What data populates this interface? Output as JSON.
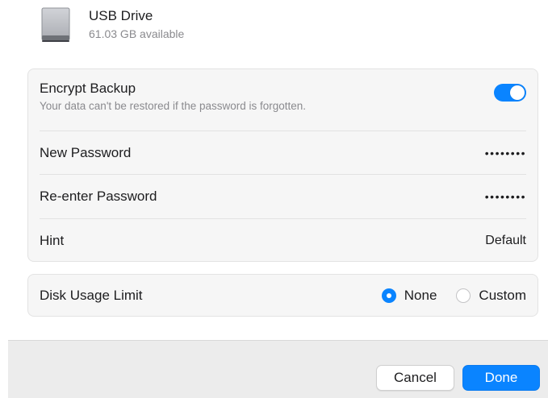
{
  "drive": {
    "icon": "external-drive-icon",
    "name": "USB Drive",
    "available": "61.03 GB available"
  },
  "encrypt": {
    "label": "Encrypt Backup",
    "description": "Your data can't be restored if the password is forgotten.",
    "enabled": true
  },
  "new_password": {
    "label": "New Password",
    "value": "••••••••"
  },
  "reenter_password": {
    "label": "Re-enter Password",
    "value": "••••••••"
  },
  "hint": {
    "label": "Hint",
    "value": "Default"
  },
  "disk_usage": {
    "label": "Disk Usage Limit",
    "options": [
      "None",
      "Custom"
    ],
    "selected": "None"
  },
  "buttons": {
    "cancel": "Cancel",
    "done": "Done"
  },
  "colors": {
    "accent": "#0a84ff",
    "footer_bg": "#ececec",
    "group_bg": "#f6f6f6"
  }
}
